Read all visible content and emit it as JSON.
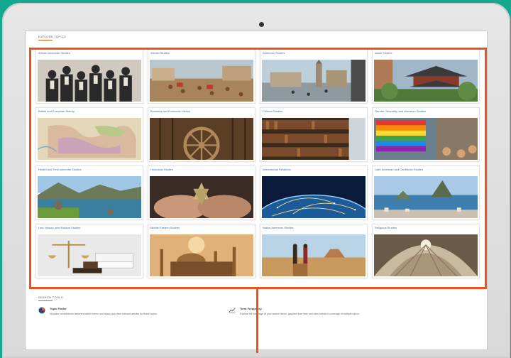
{
  "explore": {
    "header": "EXPLORE TOPICS"
  },
  "topics": [
    {
      "label": "African American Studies",
      "image": "historical-portrait-group"
    },
    {
      "label": "African Studies",
      "image": "market-street-scene"
    },
    {
      "label": "American Studies",
      "image": "colonial-town-painting"
    },
    {
      "label": "Asian Studies",
      "image": "pagoda-garden"
    },
    {
      "label": "British and European History",
      "image": "antique-map"
    },
    {
      "label": "Business and Economic History",
      "image": "mill-wheel"
    },
    {
      "label": "Cultural Studies",
      "image": "library-bookshelves"
    },
    {
      "label": "Gender, Sexuality, and Women's Studies",
      "image": "rainbow-flag"
    },
    {
      "label": "Health and Environmental Studies",
      "image": "river-landscape"
    },
    {
      "label": "Holocaust Studies",
      "image": "star-in-hands"
    },
    {
      "label": "International Relations",
      "image": "globe-network"
    },
    {
      "label": "Latin American and Caribbean Studies",
      "image": "rio-bay"
    },
    {
      "label": "Law, History, and Radical Studies",
      "image": "scales-and-gavel"
    },
    {
      "label": "Middle Eastern Studies",
      "image": "mosque-skyline"
    },
    {
      "label": "Native American Studies",
      "image": "desert-figures"
    },
    {
      "label": "Religious Studies",
      "image": "dome-interior"
    }
  ],
  "search_tools": {
    "header": "SEARCH TOOLS",
    "tools": [
      {
        "title": "Topic Finder",
        "description": "Visualize connections between search terms and topics and view relevant articles for those topics.",
        "icon": "pie-chart-icon"
      },
      {
        "title": "Term Frequency",
        "description": "Explore the coverage of your search terms, graphed over time and view trends in coverage of multiple topics.",
        "icon": "term-graph-icon"
      }
    ]
  },
  "colors": {
    "background": "#15a890",
    "highlight": "#e8541e",
    "label": "#3a6ea5"
  }
}
